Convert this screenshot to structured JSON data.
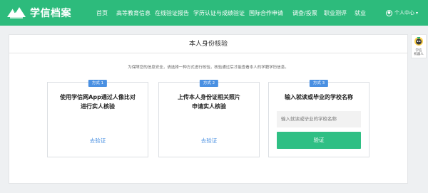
{
  "header": {
    "logo_text": "学信档案",
    "nav": [
      "首页",
      "高等教育信息",
      "在线验证报告",
      "学历认证与成绩验证",
      "国际合作申请",
      "调查/投票",
      "职业测评",
      "就业"
    ],
    "user_menu_label": "个人中心",
    "brand_color": "#2dbb7c"
  },
  "main": {
    "title": "本人身份核验",
    "notice": "为保障您的信息安全，请选择一种方式进行核验，核验通过后才能查看本人的学籍学历信息。",
    "methods": [
      {
        "badge": "方式 1",
        "desc": "使用学信网App通过人像比对\n进行实人核验",
        "link": "去验证"
      },
      {
        "badge": "方式 2",
        "desc": "上传本人身份证相关照片\n申请实人核验",
        "link": "去验证"
      },
      {
        "badge": "方式 3",
        "desc": "输入就读或毕业的学校名称",
        "input_placeholder": "输入就读或毕业的学校名称",
        "button": "验证"
      }
    ]
  },
  "robot": {
    "label": "学信\n机器人"
  }
}
